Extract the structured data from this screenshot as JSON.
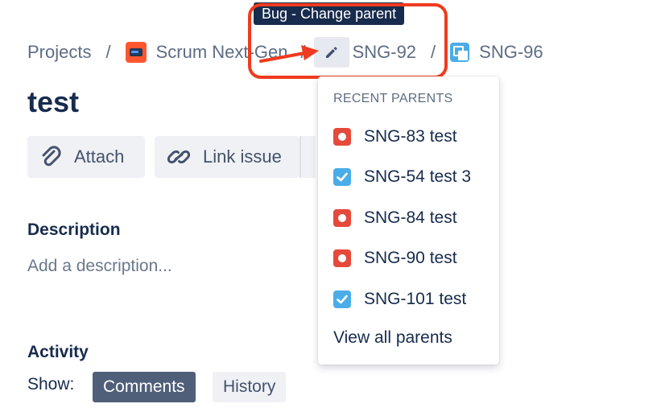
{
  "tooltip": {
    "text": "Bug - Change parent"
  },
  "breadcrumb": {
    "projects": "Projects",
    "separator": "/",
    "project": "Scrum Next-Gen",
    "parent": "SNG-92",
    "current": "SNG-96"
  },
  "issue": {
    "title": "test"
  },
  "toolbar": {
    "attach": "Attach",
    "link_issue": "Link issue"
  },
  "description": {
    "label": "Description",
    "placeholder": "Add a description..."
  },
  "activity": {
    "label": "Activity",
    "show_label": "Show:",
    "filters": [
      "Comments",
      "History"
    ],
    "selected": "Comments"
  },
  "parent_dropdown": {
    "heading": "RECENT PARENTS",
    "items": [
      {
        "label": "SNG-83 test",
        "type": "bug"
      },
      {
        "label": "SNG-54 test 3",
        "type": "task"
      },
      {
        "label": "SNG-84 test",
        "type": "bug"
      },
      {
        "label": "SNG-90 test",
        "type": "bug"
      },
      {
        "label": "SNG-101 test",
        "type": "task"
      }
    ],
    "footer": "View all parents"
  },
  "colors": {
    "annotation_red": "#ef3b1f",
    "bug_red": "#e5493a",
    "task_blue": "#4bade8",
    "text_dark": "#172b4d",
    "selected_pill": "#505f79"
  }
}
